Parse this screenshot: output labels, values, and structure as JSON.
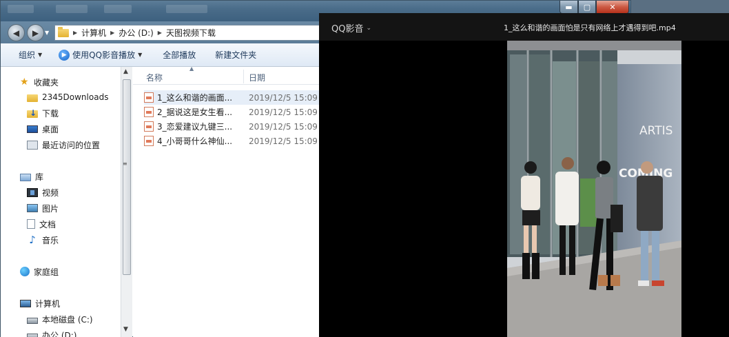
{
  "explorer": {
    "window_controls": {
      "minimize": "▬",
      "maximize": "▢",
      "close": "✕"
    },
    "address": {
      "back_glyph": "◀",
      "forward_glyph": "▶",
      "breadcrumbs": [
        "计算机",
        "办公 (D:)",
        "天图视频下载"
      ],
      "separator": "▶"
    },
    "toolbar": {
      "organize": "组织",
      "play_with_qq": "使用QQ影音播放",
      "play_all": "全部播放",
      "new_folder": "新建文件夹"
    },
    "nav": {
      "favorites_label": "收藏夹",
      "favorites": [
        "2345Downloads",
        "下载",
        "桌面",
        "最近访问的位置"
      ],
      "library_label": "库",
      "libraries": [
        "视频",
        "图片",
        "文档",
        "音乐"
      ],
      "homegroup_label": "家庭组",
      "computer_label": "计算机",
      "drives": [
        "本地磁盘 (C:)",
        "办公 (D:)"
      ]
    },
    "columns": {
      "name": "名称",
      "date": "日期"
    },
    "files": [
      {
        "name": "1_这么和谐的画面...",
        "date": "2019/12/5 15:09",
        "selected": true
      },
      {
        "name": "2_据说这是女生看...",
        "date": "2019/12/5 15:09",
        "selected": false
      },
      {
        "name": "3_恋爱建议九键三...",
        "date": "2019/12/5 15:09",
        "selected": false
      },
      {
        "name": "4_小哥哥什么神仙...",
        "date": "2019/12/5 15:09",
        "selected": false
      }
    ]
  },
  "player": {
    "brand": "QQ影音",
    "brand_arrow": "⌄",
    "filename": "1_这么和谐的画面怕是只有网络上才遇得到吧.mp4",
    "video": {
      "sign_text_1": "ARTIS",
      "sign_text_2": "COMING"
    }
  },
  "colors": {
    "titlebar": "#4a6c89",
    "player_bg": "#000000",
    "player_titlebar": "#141414",
    "selection": "#e6eef8"
  }
}
